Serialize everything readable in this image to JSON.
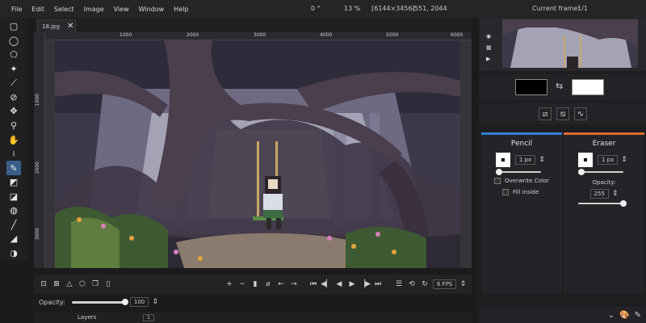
{
  "menu": [
    "File",
    "Edit",
    "Select",
    "Image",
    "View",
    "Window",
    "Help"
  ],
  "status": {
    "angle": "0 °",
    "zoom": "13 %",
    "dimensions": "[6144×3456]",
    "coords": "-551, 2044",
    "frame_label": "Current frame:",
    "frame_value": "1/1"
  },
  "tab": {
    "filename": "18.jpg",
    "close": "✕"
  },
  "rulers": {
    "horizontal": [
      "1000",
      "2000",
      "3000",
      "4000",
      "5000",
      "6000"
    ],
    "vertical": [
      "1000",
      "2000",
      "3000"
    ]
  },
  "animation": {
    "fps": "6 FPS"
  },
  "layer_opacity": {
    "label": "Opacity:",
    "value": "100",
    "fraction": 1.0
  },
  "layers": {
    "label": "Layers",
    "index": "1"
  },
  "colors": {
    "primary": "#000000",
    "secondary": "#ffffff"
  },
  "pencil": {
    "title": "Pencil",
    "accent": "#2f7fd6",
    "size": "1 px",
    "overwrite_label": "Overwrite Color",
    "fill_label": "Fill inside"
  },
  "eraser": {
    "title": "Eraser",
    "accent": "#e06a2a",
    "size": "1 px",
    "opacity_label": "Opacity:",
    "opacity_value": "255",
    "opacity_fraction": 1.0
  }
}
